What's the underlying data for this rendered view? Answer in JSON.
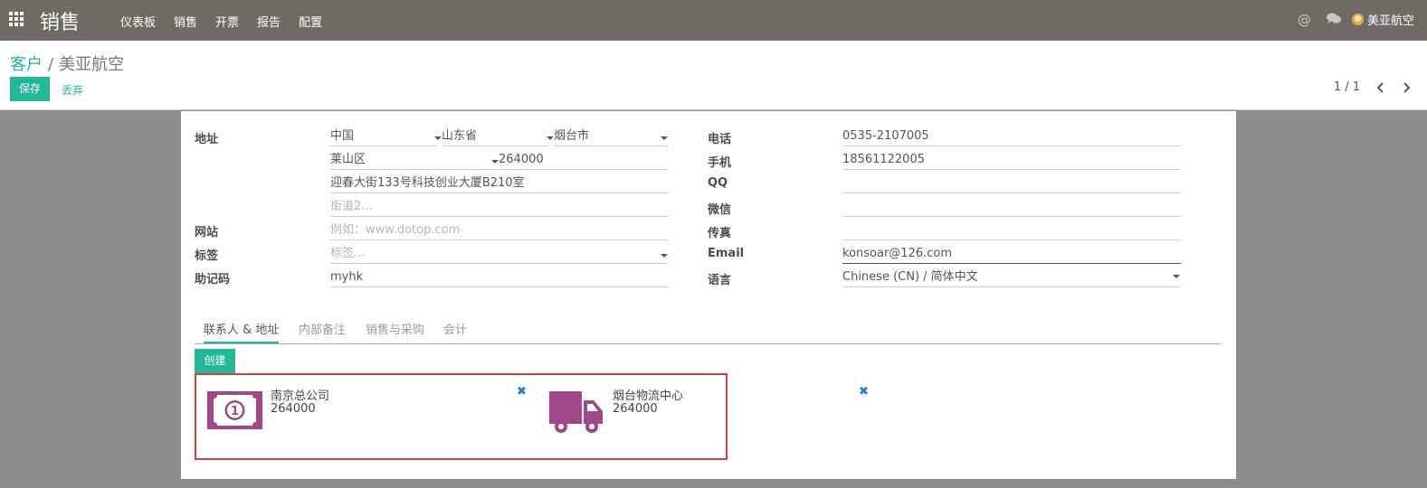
{
  "navbar": {
    "brand": "销售",
    "menu": [
      "仪表板",
      "销售",
      "开票",
      "报告",
      "配置"
    ],
    "at_symbol": "@",
    "user_name": "美亚航空"
  },
  "control": {
    "breadcrumb_parent": "客户",
    "breadcrumb_separator": "/",
    "breadcrumb_current": "美亚航空",
    "save_label": "保存",
    "discard_label": "丢弃",
    "pager": "1 / 1"
  },
  "form": {
    "labels": {
      "address": "地址",
      "website": "网站",
      "tags": "标签",
      "mnemonic": "助记码",
      "phone": "电话",
      "mobile": "手机",
      "qq": "QQ",
      "wechat": "微信",
      "fax": "传真",
      "email": "Email",
      "language": "语言"
    },
    "country": "中国",
    "state": "山东省",
    "city": "烟台市",
    "district": "莱山区",
    "zip": "264000",
    "street": "迎春大街133号科技创业大厦B210室",
    "street2_placeholder": "街道2...",
    "website_placeholder": "例如：www.dotop.com",
    "tags_placeholder": "标签...",
    "mnemonic": "myhk",
    "phone": "0535-2107005",
    "mobile": "18561122005",
    "qq": "",
    "wechat": "",
    "fax": "",
    "email": "konsoar@126.com",
    "language": "Chinese (CN) / 简体中文"
  },
  "tabs": [
    "联系人 & 地址",
    "内部备注",
    "销售与采购",
    "会计"
  ],
  "create_label": "创建",
  "contacts": [
    {
      "name": "南京总公司",
      "zip": "264000",
      "icon": "invoice-money-icon",
      "remove": "✖"
    },
    {
      "name": "烟台物流中心",
      "zip": "264000",
      "icon": "delivery-truck-icon",
      "remove": "✖"
    }
  ],
  "colors": {
    "navbar": "#6f6a64",
    "accent": "#21b799",
    "contact_icon": "#a24689",
    "highlight_border": "#e03b3b",
    "remove_icon": "#1d7ad6"
  }
}
